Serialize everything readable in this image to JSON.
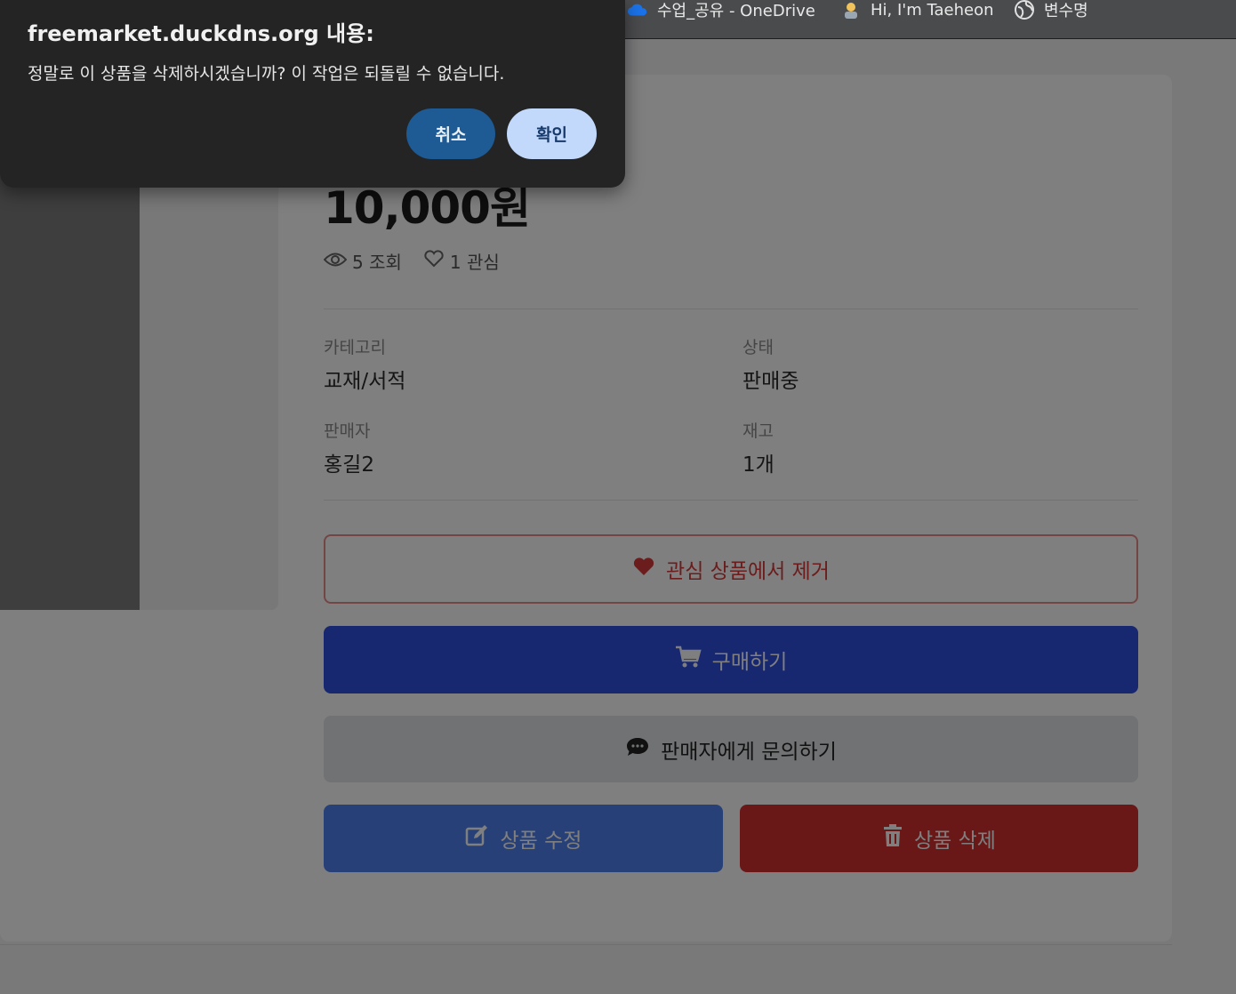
{
  "bookmarks": [
    {
      "label": "수업_공유 - OneDrive",
      "icon": "cloud-icon"
    },
    {
      "label": "Hi, I'm Taeheon",
      "icon": "person-icon"
    },
    {
      "label": "변수명",
      "icon": "globe-icon"
    }
  ],
  "product": {
    "price": "10,000원",
    "views": "5 조회",
    "likes": "1 관심",
    "category_label": "카테고리",
    "category": "교재/서적",
    "status_label": "상태",
    "status": "판매중",
    "seller_label": "판매자",
    "seller": "홍길2",
    "stock_label": "재고",
    "stock": "1개"
  },
  "actions": {
    "wishlist_remove": "관심 상품에서 제거",
    "buy": "구매하기",
    "contact_seller": "판매자에게 문의하기",
    "edit": "상품 수정",
    "delete": "상품 삭제"
  },
  "dialog": {
    "title": "freemarket.duckdns.org 내용:",
    "message": "정말로 이 상품을 삭제하시겠습니까? 이 작업은 되돌릴 수 없습니다.",
    "cancel": "취소",
    "confirm": "확인"
  },
  "colors": {
    "buy": "#2f4fe0",
    "delete": "#d32f2f",
    "edit": "#4f82f0",
    "wish": "#d63b3b",
    "dialog_bg": "#242424",
    "dialog_confirm": "#c2d9fb",
    "dialog_cancel": "#1e5a93"
  }
}
